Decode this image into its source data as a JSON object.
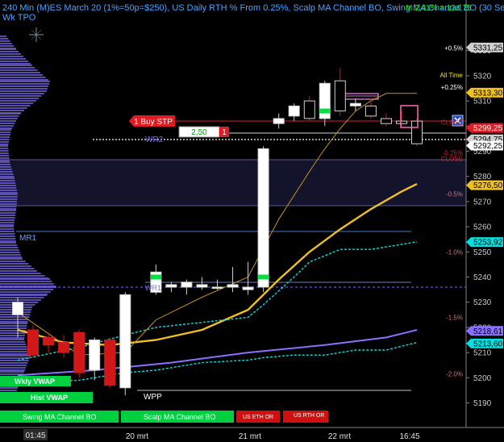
{
  "header": {
    "title": "240 Min (M)ES March 20 (1%=50p=$250), US Daily RTH % From 0.25%, Scalp MA Channel BO, Swing MA Channel BO (30 Se",
    "subtitle": "Wk TPO",
    "pnl": "M 2,41% = 124,75"
  },
  "colors": {
    "background": "#000000",
    "candle_up": "#ffffff",
    "candle_down": "#d01818",
    "vwap_fast": "#00e0e0",
    "ma_yellow": "#f0c020",
    "ma_purple": "#8a70ff",
    "order_red": "#e01b24",
    "profile": "#6a5acd"
  },
  "chart_data": {
    "type": "line",
    "ylim": [
      5186,
      5336
    ],
    "x_ticks": [
      "20 mrt",
      "21 mrt",
      "22 mrt",
      "16:45"
    ],
    "x_time_label": "01:45",
    "y_ticks": [
      5190,
      5200,
      5210,
      5220,
      5230,
      5240,
      5250,
      5260,
      5270,
      5280,
      5290,
      5300,
      5310,
      5320,
      5330
    ],
    "price_tags": [
      {
        "value": 5331.25,
        "label": "5331,25",
        "bg": "#cfcfcf",
        "fg": "#000000"
      },
      {
        "value": 5313.3,
        "label": "5313,30",
        "bg": "#f0c020",
        "fg": "#000000"
      },
      {
        "value": 5299.25,
        "label": "5299,25",
        "bg": "#e01b24",
        "fg": "#ffffff"
      },
      {
        "value": 5294.75,
        "label": "5294,75",
        "bg": "#cfcfcf",
        "fg": "#000000"
      },
      {
        "value": 5292.25,
        "label": "5292,25",
        "bg": "#ffffff",
        "fg": "#000000"
      },
      {
        "value": 5276.5,
        "label": "5276,50",
        "bg": "#f0c020",
        "fg": "#000000"
      },
      {
        "value": 5253.92,
        "label": "5253,92",
        "bg": "#00e0e0",
        "fg": "#000000"
      },
      {
        "value": 5218.61,
        "label": "5218,61",
        "bg": "#8a70ff",
        "fg": "#000000"
      },
      {
        "value": 5213.6,
        "label": "5213,60",
        "bg": "#00e0e0",
        "fg": "#000000"
      }
    ],
    "pct_labels": [
      {
        "value": 5331.0,
        "label": "+0.5%",
        "color": "#ffffff"
      },
      {
        "value": 5320.3,
        "label": "All Time",
        "color": "#f0e020"
      },
      {
        "value": 5315.5,
        "label": "+0.25%",
        "color": "#ffffff"
      },
      {
        "value": 5301.5,
        "label": "CLOSE",
        "color": "#e01b24"
      },
      {
        "value": 5289.3,
        "label": "-0.25%",
        "color": "#e01b24"
      },
      {
        "value": 5287.2,
        "label": "CLOSE",
        "color": "#e01b24"
      },
      {
        "value": 5273.0,
        "label": "-0.5%",
        "color": "#e07070"
      },
      {
        "value": 5250.0,
        "label": "-1.0%",
        "color": "#e07070"
      },
      {
        "value": 5224.0,
        "label": "-1.5%",
        "color": "#e07070"
      },
      {
        "value": 5201.5,
        "label": "-2.0%",
        "color": "#e07070"
      }
    ],
    "level_labels": [
      {
        "value": 5292.0,
        "label": "WR2"
      },
      {
        "value": 5255.5,
        "label": "MR1"
      },
      {
        "value": 5236.5,
        "label": "WR1"
      },
      {
        "value": 5199.8,
        "label": "WPP"
      }
    ],
    "candles": [
      {
        "i": 0,
        "o": 5225,
        "h": 5232,
        "l": 5216,
        "c": 5230
      },
      {
        "i": 1,
        "o": 5219,
        "h": 5221,
        "l": 5208,
        "c": 5209
      },
      {
        "i": 2,
        "o": 5216,
        "h": 5218,
        "l": 5210,
        "c": 5213
      },
      {
        "i": 3,
        "o": 5214,
        "h": 5217,
        "l": 5208,
        "c": 5210
      },
      {
        "i": 4,
        "o": 5218,
        "h": 5219,
        "l": 5200,
        "c": 5202
      },
      {
        "i": 5,
        "o": 5203,
        "h": 5216,
        "l": 5199,
        "c": 5215
      },
      {
        "i": 6,
        "o": 5215,
        "h": 5216,
        "l": 5196,
        "c": 5197
      },
      {
        "i": 7,
        "o": 5196,
        "h": 5234,
        "l": 5193,
        "c": 5233
      },
      {
        "i": 9,
        "o": 5234,
        "h": 5245,
        "l": 5233,
        "c": 5242
      },
      {
        "i": 10,
        "o": 5236,
        "h": 5238,
        "l": 5234,
        "c": 5237
      },
      {
        "i": 11,
        "o": 5236,
        "h": 5239,
        "l": 5233,
        "c": 5238
      },
      {
        "i": 12,
        "o": 5236,
        "h": 5240,
        "l": 5235,
        "c": 5237
      },
      {
        "i": 13,
        "o": 5236,
        "h": 5239,
        "l": 5235,
        "c": 5236
      },
      {
        "i": 14,
        "o": 5236,
        "h": 5244,
        "l": 5234,
        "c": 5237
      },
      {
        "i": 15,
        "o": 5235,
        "h": 5246,
        "l": 5233,
        "c": 5236
      },
      {
        "i": 16,
        "o": 5236,
        "h": 5292,
        "l": 5234,
        "c": 5291
      },
      {
        "i": 17,
        "o": 5301,
        "h": 5305,
        "l": 5299,
        "c": 5303
      },
      {
        "i": 18,
        "o": 5304,
        "h": 5309,
        "l": 5302,
        "c": 5308
      },
      {
        "i": 19,
        "o": 5310,
        "h": 5312,
        "l": 5302,
        "c": 5303
      },
      {
        "i": 20,
        "o": 5303,
        "h": 5318,
        "l": 5300,
        "c": 5317
      },
      {
        "i": 21,
        "o": 5318,
        "h": 5323,
        "l": 5304,
        "c": 5306
      },
      {
        "i": 22,
        "o": 5308,
        "h": 5311,
        "l": 5306,
        "c": 5309
      },
      {
        "i": 23,
        "o": 5308,
        "h": 5311,
        "l": 5303,
        "c": 5304
      },
      {
        "i": 24,
        "o": 5303,
        "h": 5305,
        "l": 5300,
        "c": 5301
      },
      {
        "i": 25,
        "o": 5302,
        "h": 5306,
        "l": 5300,
        "c": 5301
      },
      {
        "i": 26,
        "o": 5302,
        "h": 5303,
        "l": 5292,
        "c": 5293
      }
    ],
    "series": [
      {
        "key": "yellow_ma",
        "x": [
          0,
          3,
          6,
          9,
          12,
          15,
          17,
          19,
          21,
          23,
          25,
          26
        ],
        "y": [
          5219,
          5214,
          5213,
          5215,
          5219,
          5227,
          5239,
          5250,
          5259,
          5267,
          5274,
          5277
        ]
      },
      {
        "key": "purple_ma",
        "x": [
          0,
          5,
          10,
          15,
          20,
          24,
          26
        ],
        "y": [
          5201,
          5203,
          5206,
          5210,
          5213,
          5216,
          5219
        ]
      },
      {
        "key": "cyan_top",
        "x": [
          0,
          4,
          7,
          9,
          12,
          15,
          16,
          18,
          19,
          21,
          23,
          24,
          26
        ],
        "y": [
          5207,
          5212,
          5217,
          5220,
          5222,
          5224,
          5229,
          5240,
          5246,
          5251,
          5251,
          5252,
          5254
        ]
      },
      {
        "key": "cyan_low",
        "x": [
          0,
          4,
          7,
          9,
          12,
          15,
          16,
          18,
          20,
          22,
          24,
          26
        ],
        "y": [
          5198,
          5199,
          5202,
          5203,
          5206,
          5207,
          5208,
          5209,
          5209,
          5211,
          5211,
          5214
        ]
      },
      {
        "key": "thin_orange",
        "x": [
          0,
          4,
          7,
          9,
          12,
          15,
          17,
          19,
          20,
          21,
          22,
          23,
          24,
          25,
          26
        ],
        "y": [
          5226,
          5209,
          5210,
          5223,
          5232,
          5240,
          5263,
          5282,
          5291,
          5299,
          5306,
          5310,
          5313,
          5313,
          5313
        ]
      }
    ]
  },
  "orders": {
    "buy_stop_label": "1 Buy STP",
    "qty_value": "2,50",
    "qty_count": "1"
  },
  "bottom_labels": {
    "swing": "Swing MA Channel BO",
    "scalp": "Scalp MA Channel BO",
    "us_eth": "US ETH OR",
    "us_rth": "US RTH OR",
    "wkly_vwap": "Wkly VWAP",
    "hist_vwap": "Hist VWAP"
  }
}
